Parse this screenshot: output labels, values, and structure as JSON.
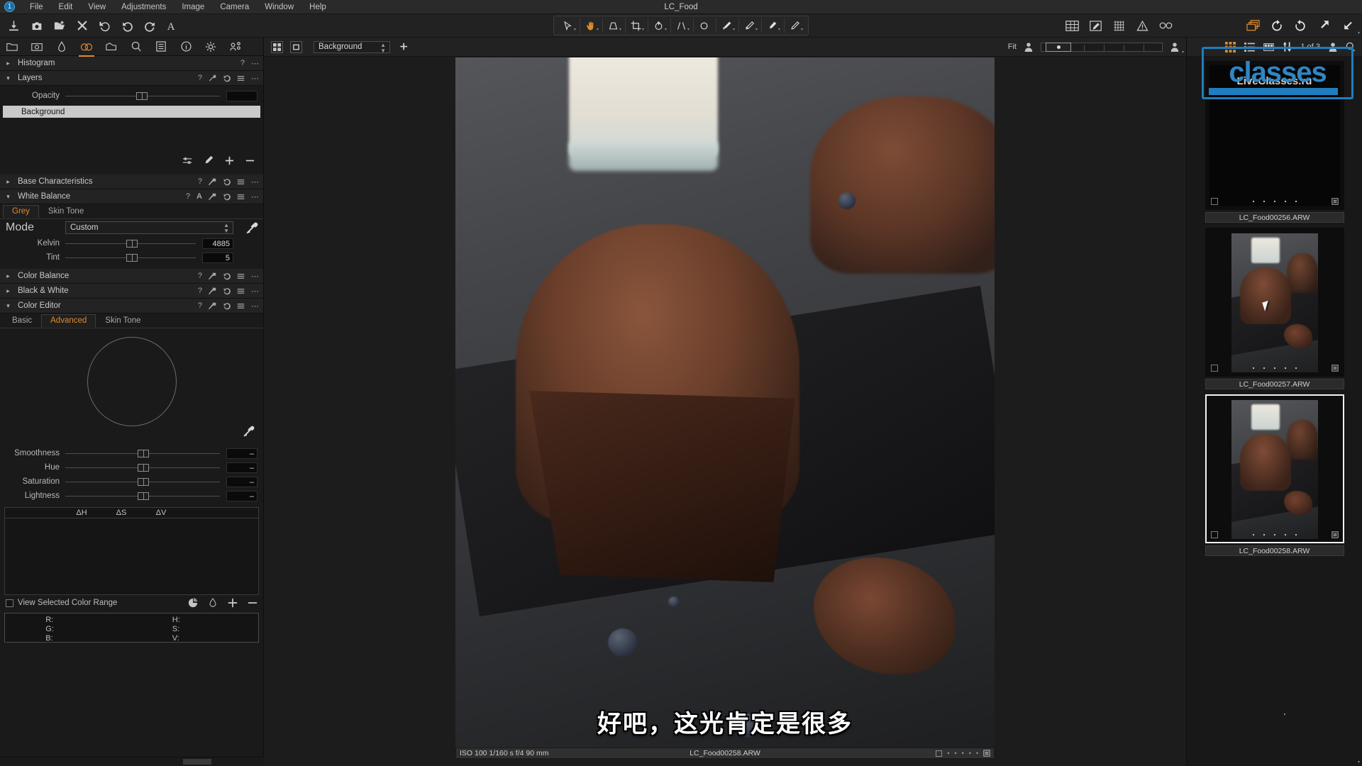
{
  "window": {
    "title": "LC_Food"
  },
  "menu": {
    "badge": "1",
    "items": [
      "File",
      "Edit",
      "View",
      "Adjustments",
      "Image",
      "Camera",
      "Window",
      "Help"
    ]
  },
  "main_toolbar": {
    "left_icons": [
      "import-icon",
      "capture-icon",
      "export-icon",
      "close-icon",
      "undo-all-icon",
      "undo-icon",
      "redo-icon",
      "annotate-text-icon"
    ],
    "center_tools": [
      "pointer-tool",
      "pan-tool",
      "keystone-tool",
      "crop-tool",
      "rotate-tool",
      "straighten-tool",
      "spot-removal-tool",
      "draw-mask-brush-tool",
      "eraser-brush-tool",
      "heal-brush-tool",
      "clone-brush-tool"
    ],
    "right_icons": [
      "grid-view-icon",
      "proof-edit-icon",
      "overlay-grid-icon",
      "warning-icon",
      "focus-mask-icon",
      "duplicate-variant-icon",
      "rotate-left-icon",
      "rotate-right-icon",
      "expand-icon",
      "collapse-icon"
    ]
  },
  "tool_tabs": {
    "icons": [
      "library-icon",
      "capture-icon",
      "lens-icon",
      "color-icon",
      "exposure-icon",
      "details-icon",
      "adjustments-icon",
      "metadata-icon",
      "output-icon",
      "batch-icon"
    ],
    "active": "color-icon"
  },
  "left_toolbar2": {
    "icons": [
      "grid-view-icon",
      "single-view-icon",
      "add-layer-icon"
    ],
    "layer_select": "Background"
  },
  "tools": {
    "histogram": {
      "title": "Histogram",
      "collapsed": true,
      "icons": [
        "help-icon",
        "menu-icon"
      ]
    },
    "layers": {
      "title": "Layers",
      "collapsed": false,
      "icons": [
        "help-icon",
        "reset-icon",
        "undo-icon",
        "menu-icon",
        "more-icon"
      ],
      "opacity_label": "Opacity",
      "opacity_value": "",
      "items": [
        {
          "name": "Background",
          "selected": true
        }
      ],
      "footer_icons": [
        "filter-icon",
        "brush-icon",
        "add-icon",
        "remove-icon"
      ]
    },
    "base_characteristics": {
      "title": "Base Characteristics",
      "collapsed": true,
      "icons": [
        "help-icon",
        "reset-icon",
        "undo-icon",
        "menu-icon",
        "more-icon"
      ]
    },
    "white_balance": {
      "title": "White Balance",
      "collapsed": false,
      "icons": [
        "help-icon",
        "auto-icon",
        "reset-icon",
        "undo-icon",
        "menu-icon",
        "more-icon"
      ],
      "tabs": [
        {
          "label": "Grey",
          "active": true
        },
        {
          "label": "Skin Tone",
          "active": false
        }
      ],
      "mode_label": "Mode",
      "mode_value": "Custom",
      "kelvin_label": "Kelvin",
      "kelvin_value": "4885",
      "tint_label": "Tint",
      "tint_value": "5",
      "picker_icon": "eyedropper-icon"
    },
    "color_balance": {
      "title": "Color Balance",
      "collapsed": true,
      "icons": [
        "help-icon",
        "reset-icon",
        "undo-icon",
        "menu-icon",
        "more-icon"
      ]
    },
    "black_and_white": {
      "title": "Black & White",
      "collapsed": true,
      "icons": [
        "help-icon",
        "reset-icon",
        "undo-icon",
        "menu-icon",
        "more-icon"
      ]
    },
    "color_editor": {
      "title": "Color Editor",
      "collapsed": false,
      "icons": [
        "help-icon",
        "reset-icon",
        "undo-icon",
        "menu-icon",
        "more-icon"
      ],
      "tabs": [
        {
          "label": "Basic",
          "active": false
        },
        {
          "label": "Advanced",
          "active": true
        },
        {
          "label": "Skin Tone",
          "active": false
        }
      ],
      "picker_icon": "eyedropper-icon",
      "sliders": [
        {
          "label": "Smoothness",
          "value": "–"
        },
        {
          "label": "Hue",
          "value": "–"
        },
        {
          "label": "Saturation",
          "value": "–"
        },
        {
          "label": "Lightness",
          "value": "–"
        }
      ],
      "delta_headers": [
        "ΔH",
        "ΔS",
        "ΔV"
      ],
      "view_selected_label": "View Selected Color Range",
      "view_selected_checked": false,
      "range_icons": [
        "pie-icon",
        "invert-icon",
        "add-icon",
        "remove-icon"
      ],
      "readout": {
        "left": [
          "R:",
          "G:",
          "B:"
        ],
        "right": [
          "H:",
          "S:",
          "V:"
        ]
      }
    }
  },
  "viewer": {
    "fit_label": "Fit",
    "zoom_icons": [
      "fit-icon",
      "zoom-person-icon"
    ],
    "subtitle": "好吧，这光肯定是很多",
    "exif": "ISO 100 1/160 s f/4 90 mm",
    "filename": "LC_Food00258.ARW",
    "rating_dots": "• • • • •",
    "tag_icon": "color-tag-icon"
  },
  "browser": {
    "counter": "1 of 3",
    "icons": [
      "grid-view-icon",
      "list-view-icon",
      "filmstrip-view-icon",
      "sort-icon",
      "user-icon",
      "search-icon"
    ],
    "thumbnails": [
      {
        "filename": "LC_Food00256.ARW",
        "selected": false,
        "dark": true,
        "overlay_text": "LiveClasses.ru"
      },
      {
        "filename": "LC_Food00257.ARW",
        "selected": false,
        "dark": false,
        "overlay_text": ""
      },
      {
        "filename": "LC_Food00258.ARW",
        "selected": true,
        "dark": false,
        "overlay_text": ""
      }
    ]
  },
  "watermark": {
    "text": "classes",
    "color": "#2f86c4"
  },
  "colors": {
    "accent": "#e08a2e",
    "panel_bg": "#1a1a1a",
    "toolbar_bg": "#222222",
    "selection": "#1f7ec0"
  }
}
